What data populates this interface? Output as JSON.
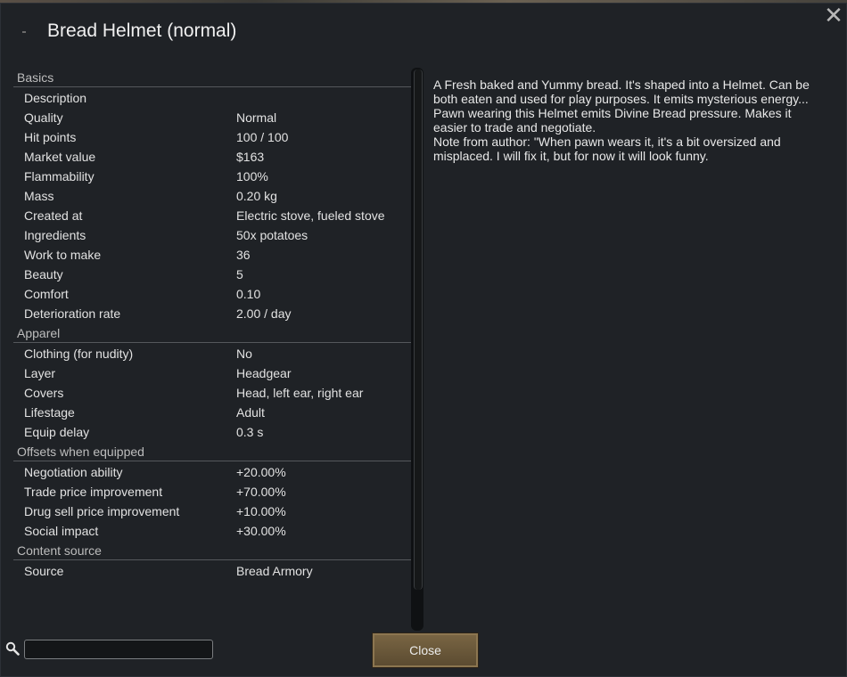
{
  "window": {
    "title": "Bread Helmet (normal)"
  },
  "sections": {
    "basics": {
      "header": "Basics",
      "rows": [
        {
          "label": "Description",
          "value": ""
        },
        {
          "label": "Quality",
          "value": "Normal"
        },
        {
          "label": "Hit points",
          "value": "100 / 100"
        },
        {
          "label": "Market value",
          "value": "$163"
        },
        {
          "label": "Flammability",
          "value": "100%"
        },
        {
          "label": "Mass",
          "value": "0.20 kg"
        },
        {
          "label": "Created at",
          "value": "Electric stove, fueled stove"
        },
        {
          "label": "Ingredients",
          "value": "50x potatoes"
        },
        {
          "label": "Work to make",
          "value": "36"
        },
        {
          "label": "Beauty",
          "value": "5"
        },
        {
          "label": "Comfort",
          "value": "0.10"
        },
        {
          "label": "Deterioration rate",
          "value": "2.00 / day"
        }
      ]
    },
    "apparel": {
      "header": "Apparel",
      "rows": [
        {
          "label": "Clothing (for nudity)",
          "value": "No"
        },
        {
          "label": "Layer",
          "value": "Headgear"
        },
        {
          "label": "Covers",
          "value": "Head, left ear, right ear"
        },
        {
          "label": "Lifestage",
          "value": "Adult"
        },
        {
          "label": "Equip delay",
          "value": "0.3 s"
        }
      ]
    },
    "offsets": {
      "header": "Offsets when equipped",
      "rows": [
        {
          "label": "Negotiation ability",
          "value": "+20.00%"
        },
        {
          "label": "Trade price improvement",
          "value": "+70.00%"
        },
        {
          "label": "Drug sell price improvement",
          "value": "+10.00%"
        },
        {
          "label": "Social impact",
          "value": "+30.00%"
        }
      ]
    },
    "content_source": {
      "header": "Content source",
      "rows": [
        {
          "label": "Source",
          "value": "Bread Armory"
        }
      ]
    }
  },
  "description": {
    "line1": "A Fresh baked and Yummy bread. It's shaped into a Helmet. Can be both eaten and used for play purposes. It emits mysterious energy...",
    "line2": "Pawn wearing this Helmet emits Divine Bread pressure. Makes it easier to trade and negotiate.",
    "line3": "Note from author: \"When pawn wears it, it's a bit oversized and misplaced. I will fix it, but for now it will look funny."
  },
  "search": {
    "value": "",
    "placeholder": ""
  },
  "buttons": {
    "close_label": "Close"
  },
  "icons": {
    "close": "close-icon",
    "search": "search-icon"
  }
}
